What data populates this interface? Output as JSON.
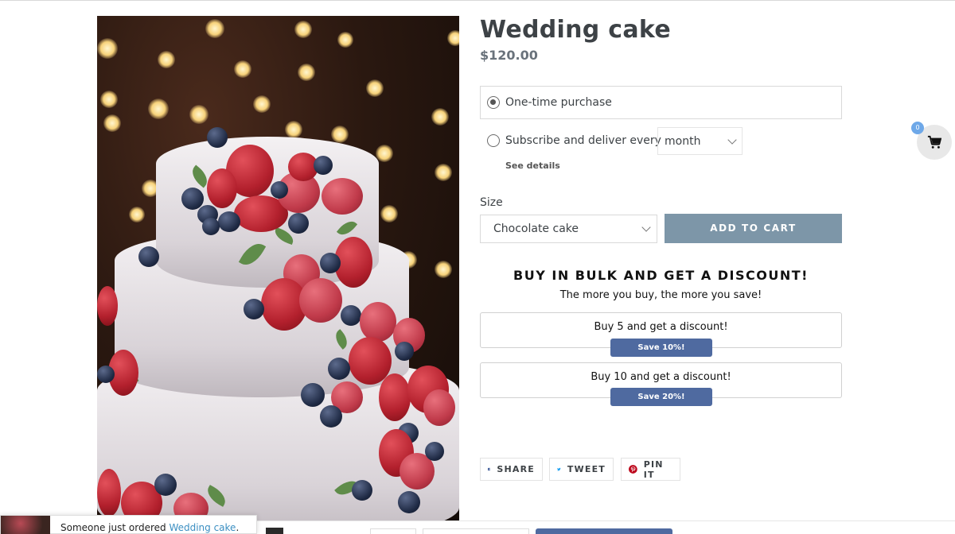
{
  "product": {
    "title": "Wedding cake",
    "price": "$120.00",
    "image_alt": "wedding-cake-photo"
  },
  "purchase_options": {
    "one_time_label": "One-time purchase",
    "subscribe_label": "Subscribe and deliver every",
    "frequency_value": "month",
    "see_details": "See details",
    "selected": "one-time"
  },
  "size": {
    "label": "Size",
    "selected": "Chocolate cake"
  },
  "add_to_cart_label": "ADD TO CART",
  "bulk": {
    "title": "BUY IN BULK AND GET A DISCOUNT!",
    "subtitle": "The more you buy, the more you save!",
    "tiers": [
      {
        "label": "Buy 5 and get a discount!",
        "badge": "Save 10%!"
      },
      {
        "label": "Buy 10 and get a discount!",
        "badge": "Save 20%!"
      }
    ]
  },
  "share": {
    "facebook": "SHARE",
    "twitter": "TWEET",
    "pinterest": "PIN IT"
  },
  "cart": {
    "count": "0"
  },
  "toast": {
    "prefix": "Someone just ordered ",
    "product": "Wedding cake",
    "suffix": "."
  },
  "colors": {
    "accent_blue": "#4f6aa0",
    "add_to_cart_bg": "#7d96a8",
    "facebook": "#3b5998",
    "twitter": "#1da1f2",
    "pinterest": "#bd081c",
    "cart_badge": "#6ea8e8"
  }
}
